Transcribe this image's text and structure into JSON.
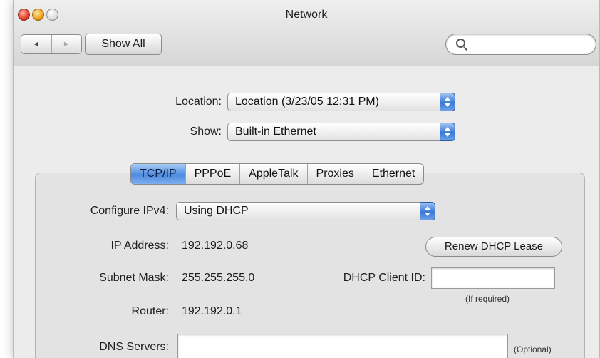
{
  "window": {
    "title": "Network"
  },
  "toolbar": {
    "back_glyph": "◄",
    "forward_glyph": "►",
    "show_all_label": "Show All",
    "search_placeholder": ""
  },
  "location": {
    "label": "Location:",
    "value": "Location (3/23/05 12:31 PM)"
  },
  "show": {
    "label": "Show:",
    "value": "Built-in Ethernet"
  },
  "tabs": [
    {
      "label": "TCP/IP",
      "active": true
    },
    {
      "label": "PPPoE",
      "active": false
    },
    {
      "label": "AppleTalk",
      "active": false
    },
    {
      "label": "Proxies",
      "active": false
    },
    {
      "label": "Ethernet",
      "active": false
    }
  ],
  "tcpip": {
    "configure_label": "Configure IPv4:",
    "configure_value": "Using DHCP",
    "ip_label": "IP Address:",
    "ip_value": "192.192.0.68",
    "renew_label": "Renew DHCP Lease",
    "subnet_label": "Subnet Mask:",
    "subnet_value": "255.255.255.0",
    "client_id_label": "DHCP Client ID:",
    "client_id_value": "",
    "client_id_hint": "(If required)",
    "router_label": "Router:",
    "router_value": "192.192.0.1",
    "dns_label": "DNS Servers:",
    "dns_value": "",
    "dns_hint": "(Optional)"
  },
  "colors": {
    "accent": "#4d8ae0",
    "window_bg": "#ececec"
  }
}
